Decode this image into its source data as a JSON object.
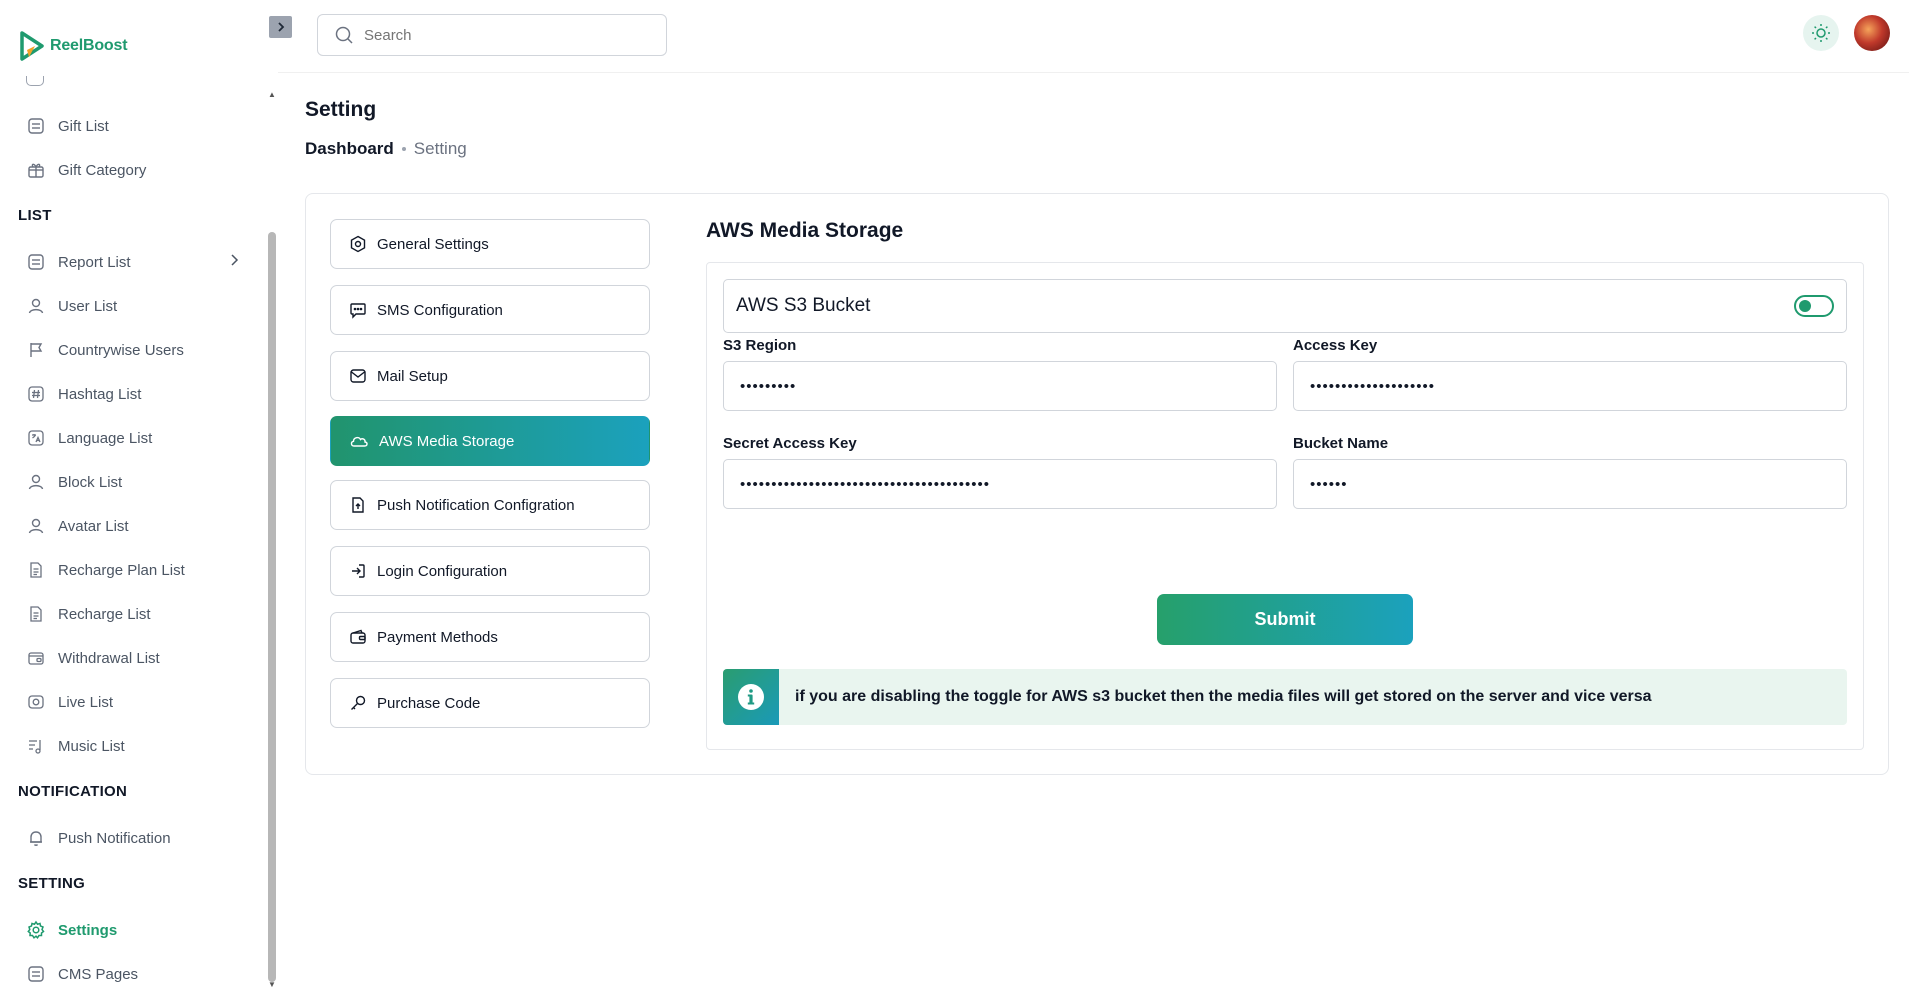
{
  "app": {
    "name": "ReelBoost"
  },
  "sidebar": {
    "items_top": [
      {
        "label": "Gift List",
        "icon": "list-icon"
      },
      {
        "label": "Gift Category",
        "icon": "gift-icon"
      }
    ],
    "sections": [
      {
        "title": "LIST"
      },
      {
        "title": "NOTIFICATION"
      },
      {
        "title": "SETTING"
      }
    ],
    "list_items": [
      {
        "label": "Report List",
        "icon": "report-icon"
      },
      {
        "label": "User List",
        "icon": "user-icon"
      },
      {
        "label": "Countrywise Users",
        "icon": "flag-icon"
      },
      {
        "label": "Hashtag List",
        "icon": "hashtag-icon"
      },
      {
        "label": "Language List",
        "icon": "language-icon"
      },
      {
        "label": "Block List",
        "icon": "user-block-icon"
      },
      {
        "label": "Avatar List",
        "icon": "avatar-icon"
      },
      {
        "label": "Recharge Plan List",
        "icon": "document-icon"
      },
      {
        "label": "Recharge List",
        "icon": "document-icon"
      },
      {
        "label": "Withdrawal List",
        "icon": "withdrawal-icon"
      },
      {
        "label": "Live List",
        "icon": "live-icon"
      },
      {
        "label": "Music List",
        "icon": "music-icon"
      }
    ],
    "notification_items": [
      {
        "label": "Push Notification",
        "icon": "bell-icon"
      }
    ],
    "setting_items": [
      {
        "label": "Settings",
        "icon": "gear-icon",
        "active": true
      },
      {
        "label": "CMS Pages",
        "icon": "pages-icon"
      }
    ]
  },
  "header": {
    "search_placeholder": "Search"
  },
  "page": {
    "title": "Setting",
    "breadcrumb": {
      "home": "Dashboard",
      "current": "Setting"
    }
  },
  "settings_menu": [
    {
      "label": "General Settings",
      "icon": "settings-hex-icon"
    },
    {
      "label": "SMS Configuration",
      "icon": "chat-icon"
    },
    {
      "label": "Mail Setup",
      "icon": "mail-icon"
    },
    {
      "label": "AWS Media Storage",
      "icon": "cloud-icon",
      "active": true
    },
    {
      "label": "Push Notification Configration",
      "icon": "file-upload-icon"
    },
    {
      "label": "Login Configuration",
      "icon": "login-icon"
    },
    {
      "label": "Payment Methods",
      "icon": "wallet-icon"
    },
    {
      "label": "Purchase Code",
      "icon": "key-icon"
    }
  ],
  "panel": {
    "title": "AWS Media Storage",
    "toggle_label": "AWS S3 Bucket",
    "toggle_on": true,
    "fields": {
      "s3_region": {
        "label": "S3 Region",
        "value": "•••••••••"
      },
      "access_key": {
        "label": "Access Key",
        "value": "••••••••••••••••••••"
      },
      "secret_key": {
        "label": "Secret Access Key",
        "value": "••••••••••••••••••••••••••••••••••••••••"
      },
      "bucket_name": {
        "label": "Bucket Name",
        "value": "••••••"
      }
    },
    "submit_label": "Submit",
    "info_text": "if you are disabling the toggle for AWS s3 bucket then the media files will get stored on the server and vice versa"
  },
  "colors": {
    "accent": "#1f9a6e",
    "accent_end": "#1ba1bd"
  }
}
